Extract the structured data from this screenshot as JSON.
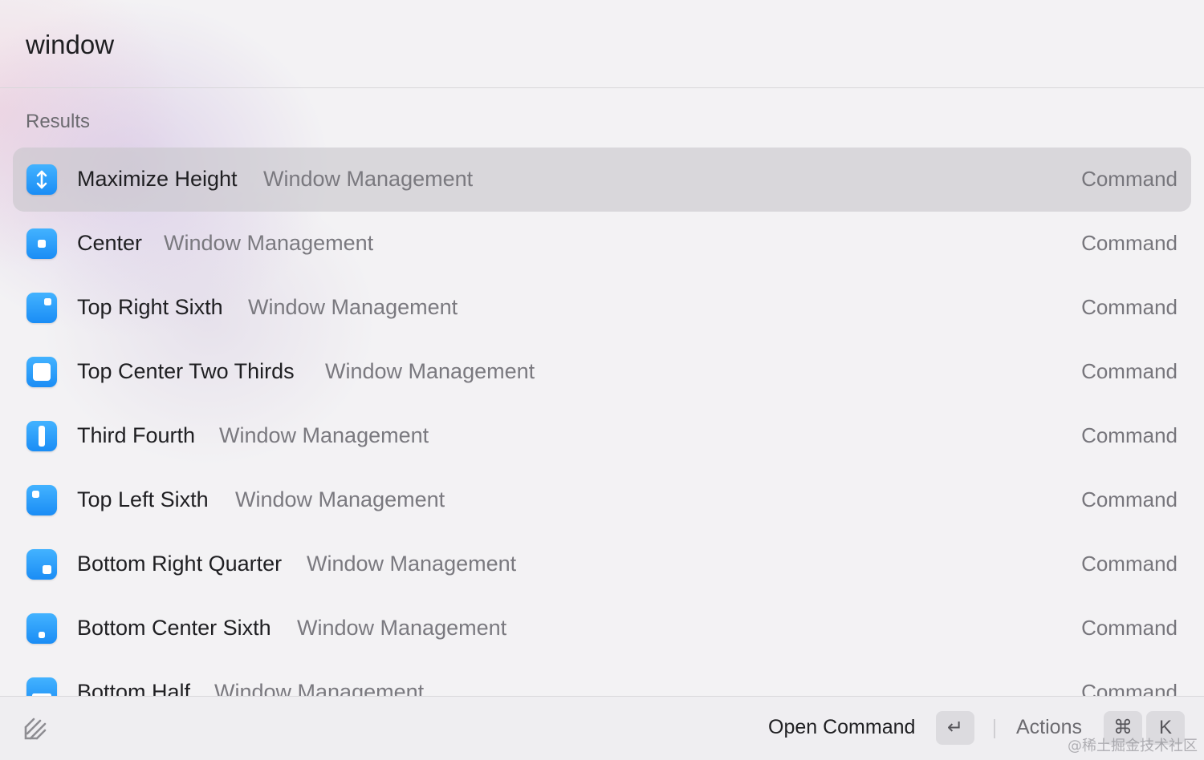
{
  "search": {
    "value": "window"
  },
  "section_title": "Results",
  "results": [
    {
      "title": "Maximize Height",
      "subtitle": "Window Management",
      "kind": "Command",
      "icon": "maximize-height-icon",
      "selected": true
    },
    {
      "title": "Center",
      "subtitle": "Window Management",
      "kind": "Command",
      "icon": "center-window-icon"
    },
    {
      "title": "Top Right Sixth",
      "subtitle": "Window Management",
      "kind": "Command",
      "icon": "top-right-sixth-icon"
    },
    {
      "title": "Top Center Two Thirds",
      "subtitle": "Window Management",
      "kind": "Command",
      "icon": "top-center-two-thirds-icon"
    },
    {
      "title": "Third Fourth",
      "subtitle": "Window Management",
      "kind": "Command",
      "icon": "third-fourth-icon"
    },
    {
      "title": "Top Left Sixth",
      "subtitle": "Window Management",
      "kind": "Command",
      "icon": "top-left-sixth-icon"
    },
    {
      "title": "Bottom Right Quarter",
      "subtitle": "Window Management",
      "kind": "Command",
      "icon": "bottom-right-quarter-icon"
    },
    {
      "title": "Bottom Center Sixth",
      "subtitle": "Window Management",
      "kind": "Command",
      "icon": "bottom-center-sixth-icon"
    },
    {
      "title": "Bottom Half",
      "subtitle": "Window Management",
      "kind": "Command",
      "icon": "bottom-half-icon"
    }
  ],
  "footer": {
    "logo_icon": "raycast-logo-icon",
    "primary_action": "Open Command",
    "primary_key": "↵",
    "actions_label": "Actions",
    "actions_keys": [
      "⌘",
      "K"
    ]
  },
  "watermark": "@稀土掘金技术社区",
  "colors": {
    "accent": "#1a8df5",
    "selected_row": "#d2d0d5",
    "text_primary": "#1f1f22",
    "text_secondary": "#7a797f"
  }
}
